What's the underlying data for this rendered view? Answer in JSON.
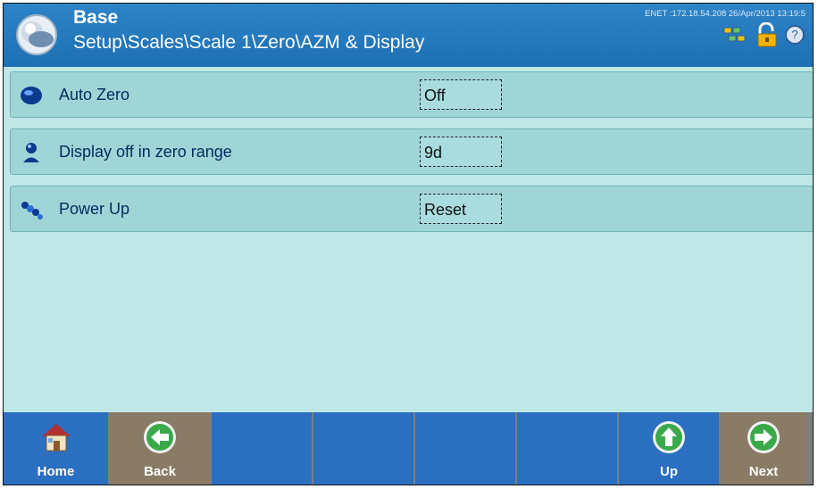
{
  "header": {
    "title": "Base",
    "path": "Setup\\Scales\\Scale 1\\Zero\\AZM & Display",
    "meta": "ENET :172.18.54.208  26/Apr/2013 13:19:5",
    "icons": [
      "network-icon",
      "lock-icon",
      "help-icon"
    ]
  },
  "rows": [
    {
      "label": "Auto Zero",
      "value": "Off",
      "icon": "blue-oval-icon"
    },
    {
      "label": "Display off in zero range",
      "value": "9d",
      "icon": "person-icon"
    },
    {
      "label": "Power Up",
      "value": "Reset",
      "icon": "power-up-icon"
    }
  ],
  "footer": {
    "buttons": [
      {
        "label": "Home",
        "icon": "home-icon"
      },
      {
        "label": "Back",
        "icon": "back-arrow-icon"
      },
      {
        "label": ""
      },
      {
        "label": ""
      },
      {
        "label": ""
      },
      {
        "label": ""
      },
      {
        "label": "Up",
        "icon": "up-arrow-icon"
      },
      {
        "label": "Next",
        "icon": "next-arrow-icon"
      }
    ]
  },
  "colors": {
    "header_blue": "#2e84c8",
    "panel_bg": "#bfe7e7",
    "row_bg": "#9fd5d7",
    "footer_blue": "#2b6fc1",
    "footer_tan": "#8a7b66",
    "arrow_green": "#3aa94a"
  }
}
